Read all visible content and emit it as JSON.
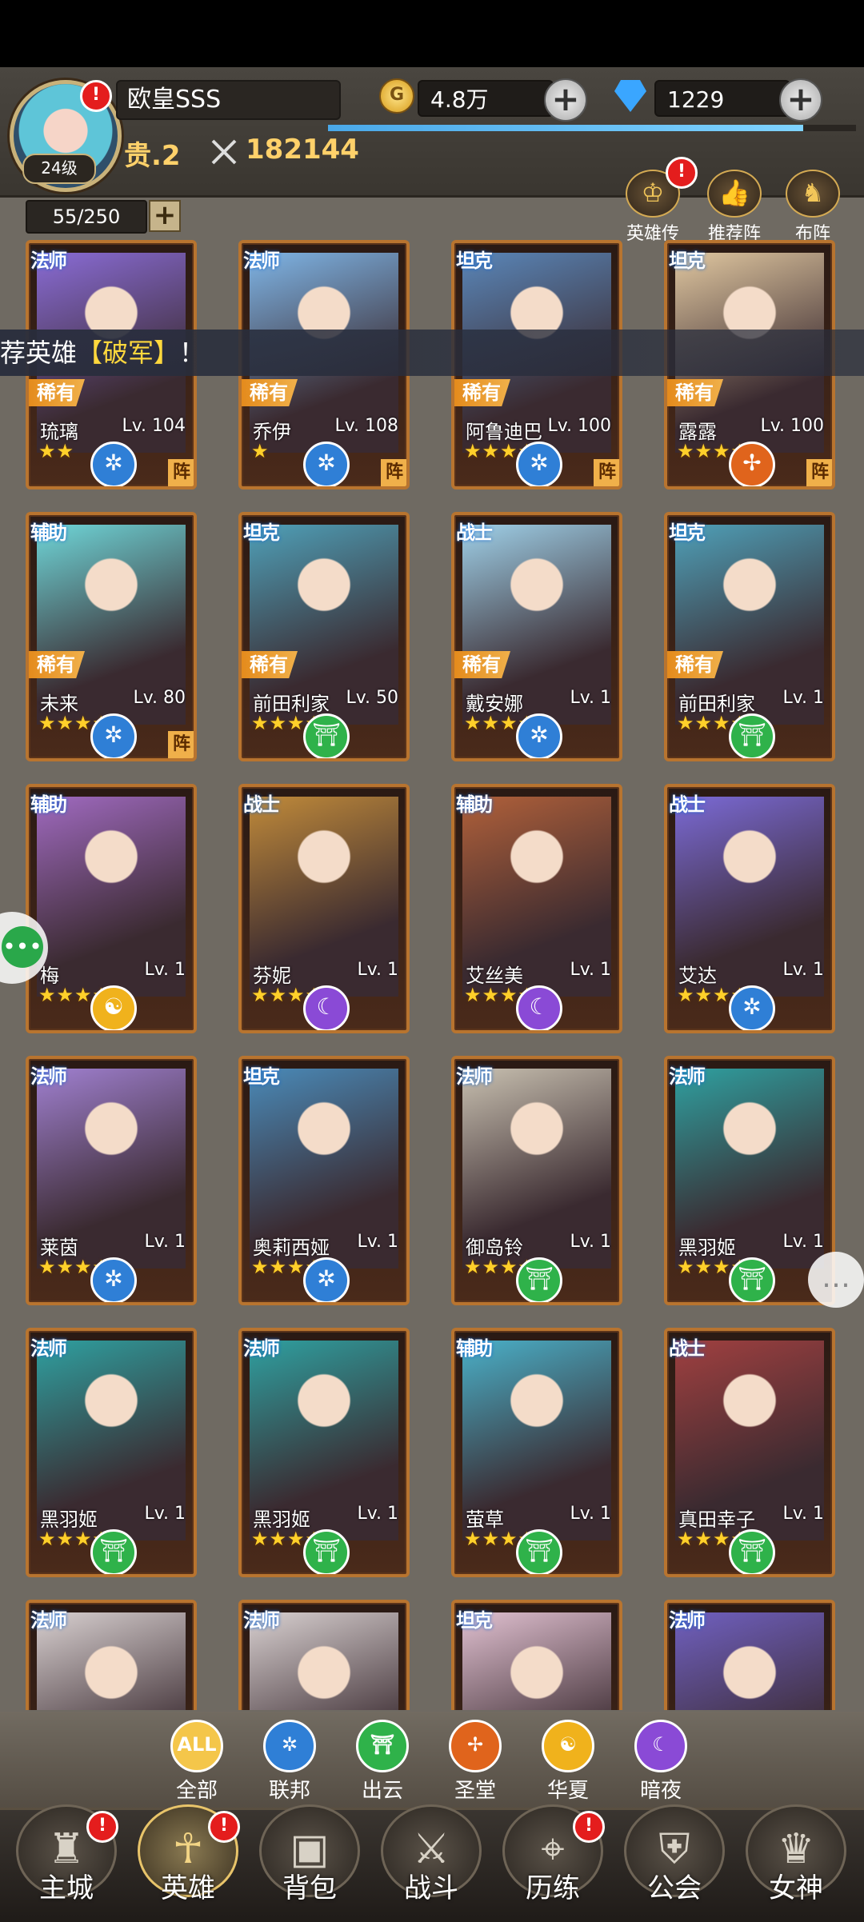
{
  "player": {
    "name": "欧皇SSS",
    "level": "24级",
    "rank": "贵.2",
    "power": "182144",
    "gold": "4.8万",
    "gems": "1229",
    "xp_fraction": 0.9
  },
  "roster": {
    "count": "55/250"
  },
  "toolbar": [
    {
      "label": "英雄传",
      "icon": "crown-icon"
    },
    {
      "label": "推荐阵",
      "icon": "thumbs-up-icon"
    },
    {
      "label": "布阵",
      "icon": "horse-icon"
    }
  ],
  "banner": {
    "prefix": "荐英雄",
    "highlight": "【破军】",
    "suffix": "！"
  },
  "heroes": [
    {
      "role": "法师",
      "rarity": "稀有",
      "name": "琉璃",
      "level": "Lv. 104",
      "stars": "★★",
      "faction": "联邦",
      "zhen": "阵"
    },
    {
      "role": "法师",
      "rarity": "稀有",
      "name": "乔伊",
      "level": "Lv. 108",
      "stars": "★",
      "faction": "联邦",
      "zhen": "阵"
    },
    {
      "role": "坦克",
      "rarity": "稀有",
      "name": "阿鲁迪巴",
      "level": "Lv. 100",
      "stars": "★★★★★",
      "faction": "联邦",
      "zhen": "阵"
    },
    {
      "role": "坦克",
      "rarity": "稀有",
      "name": "露露",
      "level": "Lv. 100",
      "stars": "★★★★★",
      "faction": "圣堂",
      "zhen": "阵"
    },
    {
      "role": "辅助",
      "rarity": "稀有",
      "name": "未来",
      "level": "Lv. 80",
      "stars": "★★★★★",
      "faction": "联邦",
      "zhen": "阵"
    },
    {
      "role": "坦克",
      "rarity": "稀有",
      "name": "前田利家",
      "level": "Lv. 50",
      "stars": "★★★★★",
      "faction": "出云",
      "zhen": ""
    },
    {
      "role": "战士",
      "rarity": "稀有",
      "name": "戴安娜",
      "level": "Lv. 1",
      "stars": "★★★★★",
      "faction": "联邦",
      "zhen": ""
    },
    {
      "role": "坦克",
      "rarity": "稀有",
      "name": "前田利家",
      "level": "Lv. 1",
      "stars": "★★★★★",
      "faction": "出云",
      "zhen": ""
    },
    {
      "role": "辅助",
      "rarity": "",
      "name": "梅",
      "level": "Lv. 1",
      "stars": "★★★★★",
      "faction": "华夏",
      "zhen": ""
    },
    {
      "role": "战士",
      "rarity": "",
      "name": "芬妮",
      "level": "Lv. 1",
      "stars": "★★★★★",
      "faction": "暗夜",
      "zhen": ""
    },
    {
      "role": "辅助",
      "rarity": "",
      "name": "艾丝美",
      "level": "Lv. 1",
      "stars": "★★★★★",
      "faction": "暗夜",
      "zhen": ""
    },
    {
      "role": "战士",
      "rarity": "",
      "name": "艾达",
      "level": "Lv. 1",
      "stars": "★★★★★",
      "faction": "联邦",
      "zhen": ""
    },
    {
      "role": "法师",
      "rarity": "",
      "name": "莱茵",
      "level": "Lv. 1",
      "stars": "★★★★★",
      "faction": "联邦",
      "zhen": ""
    },
    {
      "role": "坦克",
      "rarity": "",
      "name": "奥莉西娅",
      "level": "Lv. 1",
      "stars": "★★★★★",
      "faction": "联邦",
      "zhen": ""
    },
    {
      "role": "法师",
      "rarity": "",
      "name": "御岛铃",
      "level": "Lv. 1",
      "stars": "★★★★★",
      "faction": "出云",
      "zhen": ""
    },
    {
      "role": "法师",
      "rarity": "",
      "name": "黑羽姬",
      "level": "Lv. 1",
      "stars": "★★★★★",
      "faction": "出云",
      "zhen": ""
    },
    {
      "role": "法师",
      "rarity": "",
      "name": "黑羽姬",
      "level": "Lv. 1",
      "stars": "★★★★★",
      "faction": "出云",
      "zhen": ""
    },
    {
      "role": "法师",
      "rarity": "",
      "name": "黑羽姬",
      "level": "Lv. 1",
      "stars": "★★★★★",
      "faction": "出云",
      "zhen": ""
    },
    {
      "role": "辅助",
      "rarity": "",
      "name": "萤草",
      "level": "Lv. 1",
      "stars": "★★★★★",
      "faction": "出云",
      "zhen": ""
    },
    {
      "role": "战士",
      "rarity": "",
      "name": "真田幸子",
      "level": "Lv. 1",
      "stars": "★★★★★",
      "faction": "出云",
      "zhen": ""
    },
    {
      "role": "法师",
      "rarity": "",
      "name": "",
      "level": "",
      "stars": "",
      "faction": "",
      "zhen": ""
    },
    {
      "role": "法师",
      "rarity": "",
      "name": "",
      "level": "",
      "stars": "",
      "faction": "",
      "zhen": ""
    },
    {
      "role": "坦克",
      "rarity": "",
      "name": "",
      "level": "",
      "stars": "",
      "faction": "",
      "zhen": ""
    },
    {
      "role": "法师",
      "rarity": "",
      "name": "",
      "level": "",
      "stars": "",
      "faction": "",
      "zhen": ""
    }
  ],
  "factions": [
    {
      "label": "全部",
      "icon": "ALL",
      "color": "#f4c64a"
    },
    {
      "label": "联邦",
      "icon": "✲",
      "color": "#2f7fd6"
    },
    {
      "label": "出云",
      "icon": "⛩",
      "color": "#2fb24a"
    },
    {
      "label": "圣堂",
      "icon": "✢",
      "color": "#e0641c"
    },
    {
      "label": "华夏",
      "icon": "☯",
      "color": "#f0b21c"
    },
    {
      "label": "暗夜",
      "icon": "☾",
      "color": "#8a4ad6"
    }
  ],
  "nav": [
    {
      "label": "主城",
      "icon": "♜",
      "badge": "!"
    },
    {
      "label": "英雄",
      "icon": "☥",
      "badge": "!"
    },
    {
      "label": "背包",
      "icon": "▣",
      "badge": ""
    },
    {
      "label": "战斗",
      "icon": "⚔",
      "badge": ""
    },
    {
      "label": "历练",
      "icon": "⌖",
      "badge": "!"
    },
    {
      "label": "公会",
      "icon": "⛨",
      "badge": ""
    },
    {
      "label": "女神",
      "icon": "♛",
      "badge": ""
    }
  ]
}
